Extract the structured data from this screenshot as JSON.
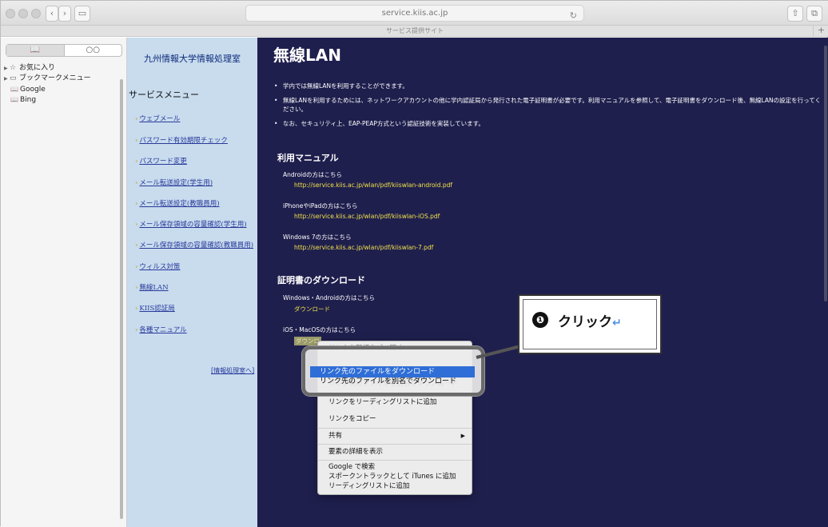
{
  "browser": {
    "address": "service.kiis.ac.jp",
    "tab_title": "サービス提供サイト",
    "tab_plus": "+",
    "reload": "↻"
  },
  "sidebar": {
    "seg_bookmarks": "📖",
    "seg_reading": "○○",
    "items": [
      {
        "label": "お気に入り",
        "icon": "☆",
        "arrow": "▶"
      },
      {
        "label": "ブックマークメニュー",
        "icon": "▭",
        "arrow": "▶"
      },
      {
        "label": "Google",
        "icon": "📖"
      },
      {
        "label": "Bing",
        "icon": "📖"
      }
    ]
  },
  "nav": {
    "site_title": "九州情報大学情報処理室",
    "service_heading": "サービスメニュー",
    "links": [
      "ウェブメール",
      "パスワード有効期限チェック",
      "パスワード変更",
      "メール転送設定(学生用)",
      "メール転送設定(教職員用)",
      "メール保存領域の容量確認(学生用)",
      "メール保存領域の容量確認(教職員用)",
      "ウィルス対策",
      "無線LAN",
      "KIIS認証局",
      "各種マニュアル"
    ],
    "arrow_glyph": "›",
    "info_link": "[情報処理室へ]"
  },
  "main": {
    "title": "無線LAN",
    "bullets": [
      "学内では無線LANを利用することができます。",
      "無線LANを利用するためには、ネットワークアカウントの他に学内認証局から発行された電子証明書が必要です。利用マニュアルを参照して、電子証明書をダウンロード後、無線LANの設定を行ってください。",
      "なお、セキュリティ上、EAP-PEAP方式という認証技術を実装しています。"
    ],
    "manual_heading": "利用マニュアル",
    "manuals": [
      {
        "caption": "Androidの方はこちら",
        "url": "http://service.kiis.ac.jp/wlan/pdf/kiiswlan-android.pdf"
      },
      {
        "caption": "iPhoneやiPadの方はこちら",
        "url": "http://service.kiis.ac.jp/wlan/pdf/kiiswlan-iOS.pdf"
      },
      {
        "caption": "Windows 7の方はこちら",
        "url": "http://service.kiis.ac.jp/wlan/pdf/kiiswlan-7.pdf"
      }
    ],
    "cert_heading": "証明書のダウンロード",
    "certs": [
      {
        "caption": "Windows・Androidの方はこちら",
        "link": "ダウンロード"
      },
      {
        "caption": "iOS・MacOSの方はこちら",
        "link": "ダウンロ"
      }
    ]
  },
  "context_menu": {
    "items": [
      "リンクを新規タブで開く",
      "リンク先のファイルをダウンロード",
      "リンク先のファイルを別名でダウンロード",
      "リンクをリーディングリストに追加",
      "リンクをコピー",
      "共有",
      "要素の詳細を表示",
      "Google で検索",
      "スポークントラックとして iTunes に追加",
      "リーディングリストに追加"
    ],
    "submenu_arrow": "▶"
  },
  "callout": {
    "number": "❶",
    "text": "クリック",
    "return_mark": "↵"
  }
}
